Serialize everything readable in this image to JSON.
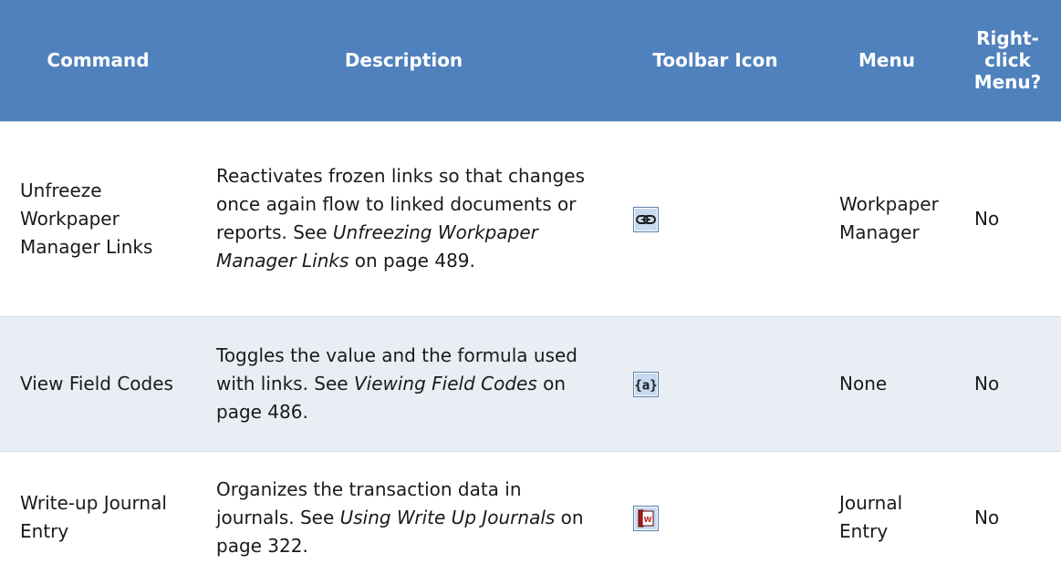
{
  "headers": {
    "command": "Command",
    "description": "Description",
    "toolbar_icon": "Toolbar Icon",
    "menu": "Menu",
    "right_click": "Right-click Menu?"
  },
  "rows": [
    {
      "command": "Unfreeze Workpaper Manager Links",
      "desc_pre": "Reactivates frozen links so that changes once again flow to linked documents or reports. See ",
      "desc_link": "Unfreezing Workpaper Manager Links",
      "desc_post": " on page 489.",
      "icon": "chain-link-icon",
      "menu": "Workpaper Manager",
      "right_click": "No"
    },
    {
      "command": "View Field Codes",
      "desc_pre": "Toggles the value and the formula used with links. See ",
      "desc_link": "Viewing Field Codes",
      "desc_post": " on page 486.",
      "icon": "field-code-braces-icon",
      "menu": "None",
      "right_click": "No"
    },
    {
      "command": "Write-up Journal Entry",
      "desc_pre": "Organizes the transaction data in journals. See ",
      "desc_link": "Using Write Up Journals",
      "desc_post": " on page 322.",
      "icon": "journal-book-icon",
      "menu": "Journal Entry",
      "right_click": "No"
    }
  ],
  "colors": {
    "header_bg": "#4f81bd",
    "header_text": "#ffffff",
    "alt_row_bg": "#e9edf4",
    "icon_bg": "#c6d9ee"
  }
}
